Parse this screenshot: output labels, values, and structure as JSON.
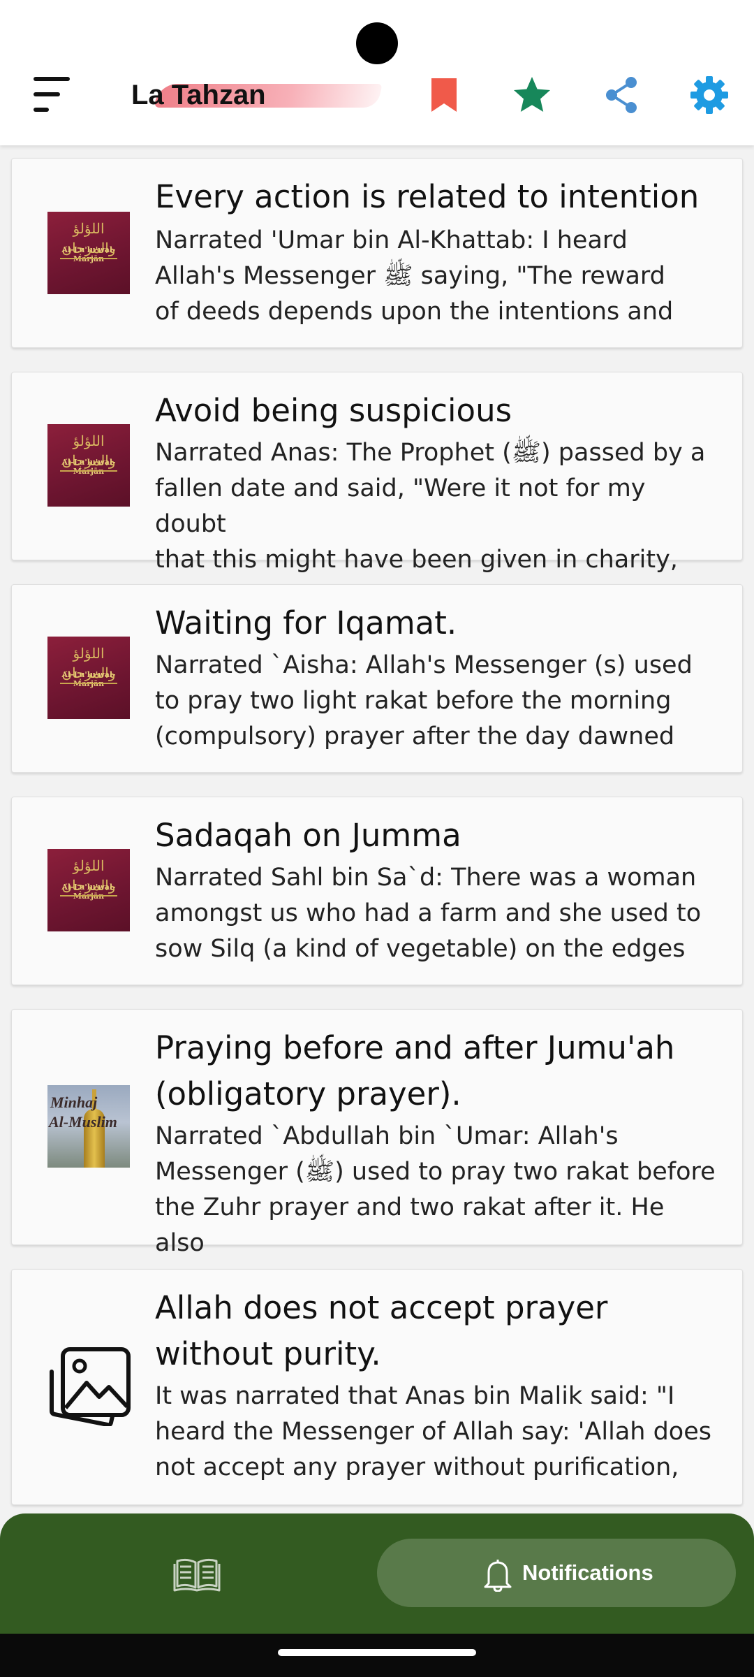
{
  "header": {
    "title": "La Tahzan",
    "icons": [
      "menu-icon",
      "bookmark-icon",
      "star-icon",
      "share-icon",
      "settings-icon"
    ],
    "colors": {
      "bookmark": "#f05a4a",
      "star": "#17875a",
      "share": "#4a8fd1",
      "settings": "#1e9be2"
    }
  },
  "hadiths": [
    {
      "title": "Every action is related to intention",
      "body_lines": [
        "Narrated 'Umar bin Al-Khattab: I heard",
        "Allah's Messenger ﷺ  saying, \"The reward",
        "of deeds depends upon the intentions and"
      ],
      "thumb": "book-cover"
    },
    {
      "title": "Avoid being suspicious",
      "body_lines": [
        "Narrated Anas: The Prophet (ﷺ) passed by a",
        "fallen date and said, \"Were it not for my doubt",
        "that this might have been given in charity,"
      ],
      "thumb": "book-cover"
    },
    {
      "title": "Waiting for Iqamat.",
      "body_lines": [
        "Narrated `Aisha: Allah's Messenger (s) used",
        "to pray two light rakat before the morning",
        "(compulsory) prayer after the day dawned"
      ],
      "thumb": "book-cover"
    },
    {
      "title": "Sadaqah on Jumma",
      "body_lines": [
        "Narrated Sahl bin Sa`d: There was a woman",
        "amongst us who had a farm and she used to",
        "sow Silq (a kind of vegetable) on the edges"
      ],
      "thumb": "book-cover"
    },
    {
      "title_lines": [
        "Praying before and after Jumu'ah",
        "(obligatory prayer)."
      ],
      "body_lines": [
        "Narrated `Abdullah bin `Umar: Allah's",
        "Messenger (ﷺ) used to pray two rakat before",
        "the Zuhr prayer and two rakat after it. He also"
      ],
      "thumb": "minhaj-cover"
    },
    {
      "title_lines": [
        "Allah does not accept prayer",
        "without purity."
      ],
      "body_lines": [
        "It was narrated that Anas bin Malik said: \"I",
        "heard the Messenger of Allah say: 'Allah does",
        "not accept any prayer without purification,"
      ],
      "thumb": "image-placeholder"
    }
  ],
  "covers": {
    "book": {
      "arabic": "اللؤلؤ والمرجان",
      "title": "Al-Lu'lu'wal-Marjān"
    },
    "minhaj": {
      "line1": "Minhaj",
      "line2": "Al-Muslim"
    }
  },
  "bottom_nav": {
    "book_icon": "book-icon",
    "notifications_label": "Notifications",
    "bell_icon": "bell-icon",
    "background": "#335b21",
    "pill_color": "#597a4a"
  }
}
